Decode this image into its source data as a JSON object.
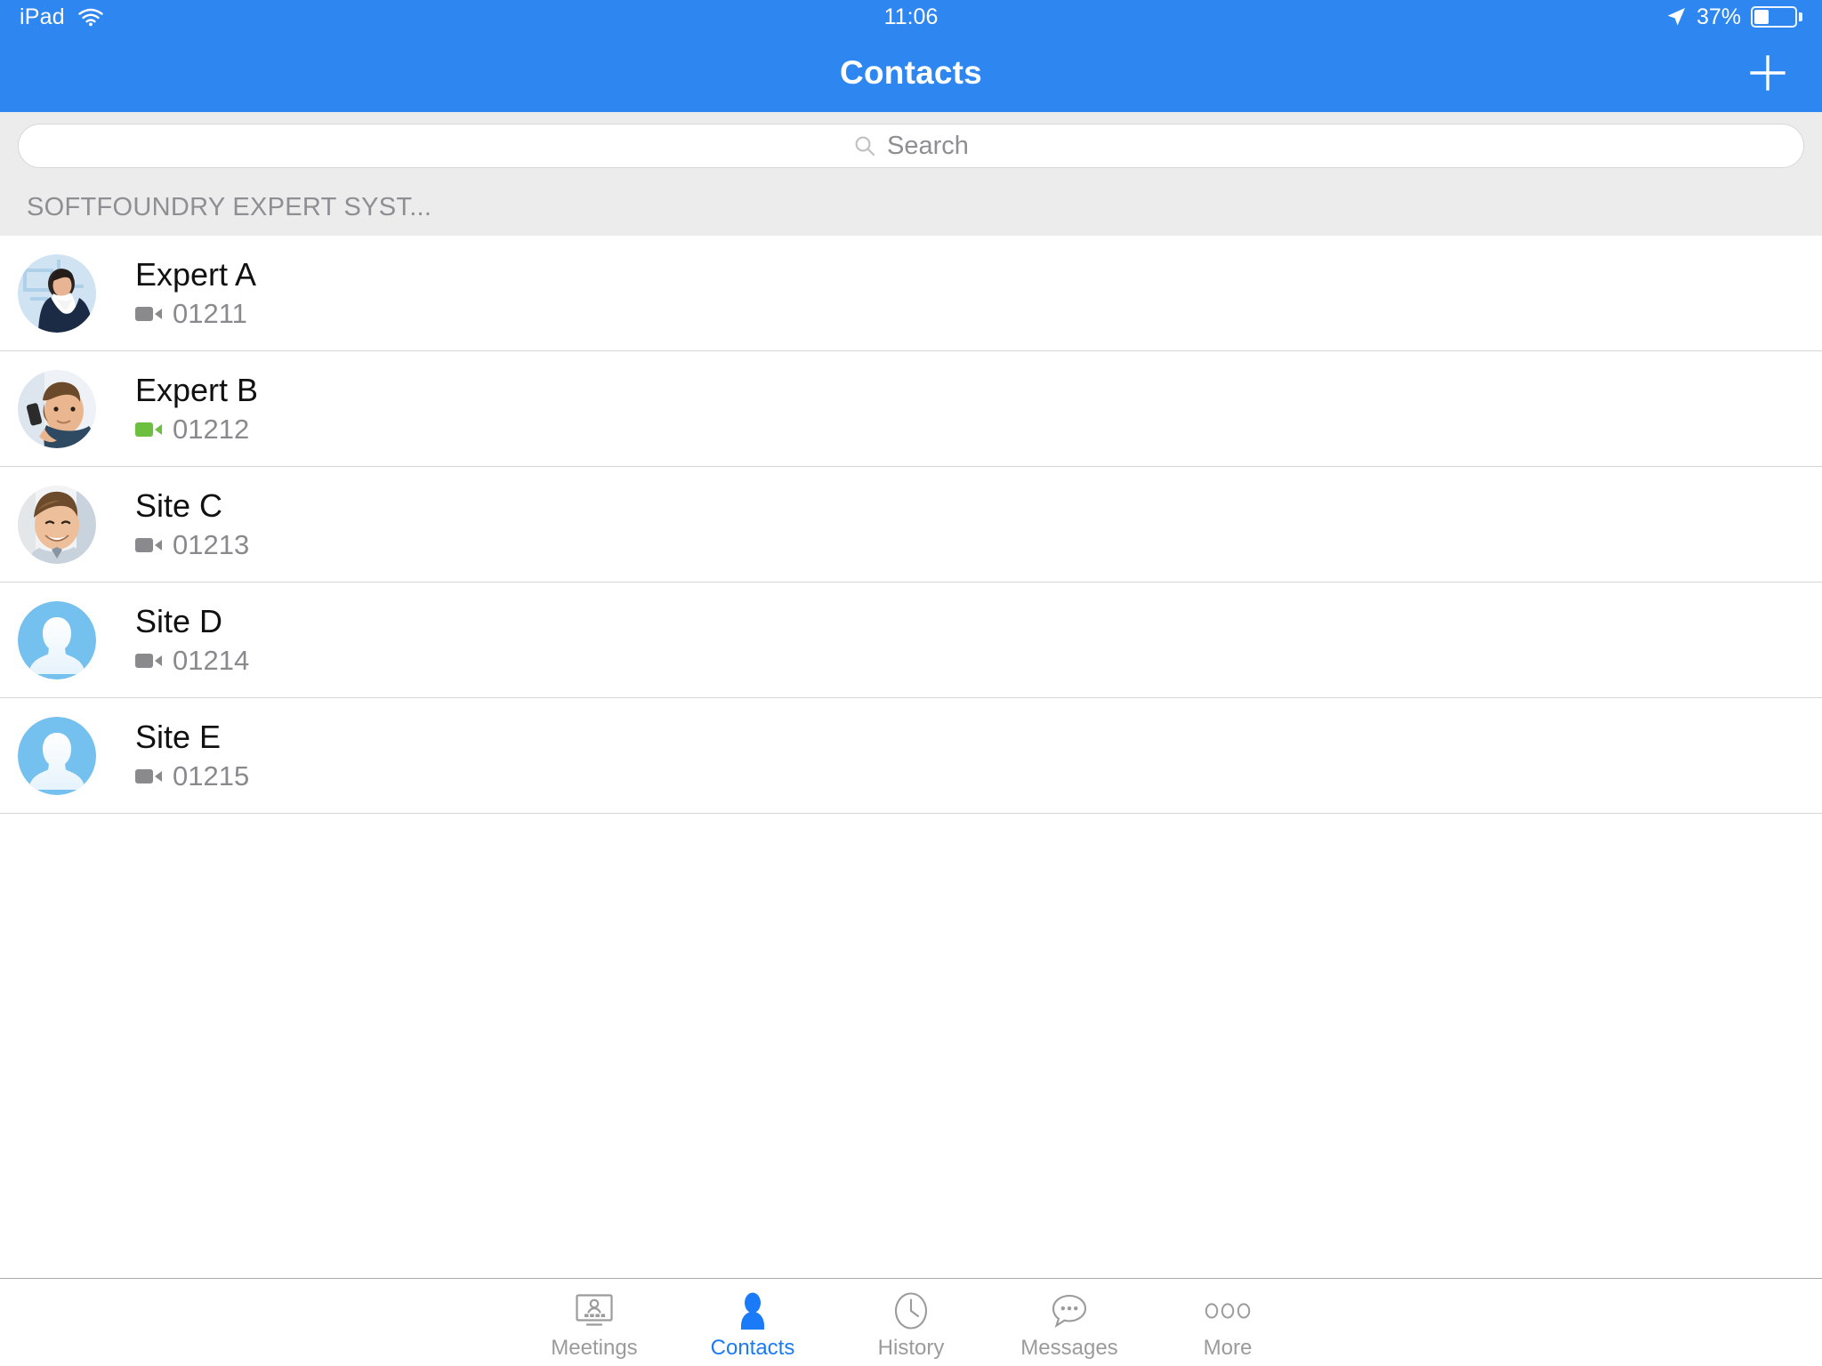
{
  "statusbar": {
    "device": "iPad",
    "wifi_icon": "wifi-icon",
    "time": "11:06",
    "location_icon": "location-arrow-icon",
    "battery_percent": "37%",
    "battery_level": 37
  },
  "navbar": {
    "title": "Contacts",
    "add_icon": "plus-icon",
    "background_color": "#2e86f0"
  },
  "search": {
    "placeholder": "Search",
    "value": "",
    "icon": "search-icon"
  },
  "section": {
    "header": "SOFTFOUNDRY EXPERT SYST..."
  },
  "contacts": [
    {
      "name": "Expert A",
      "extension": "01211",
      "status": "offline",
      "status_color": "#8a8a8e",
      "avatar_type": "photo",
      "avatar_desc": "woman-in-dark-blazer-photo"
    },
    {
      "name": "Expert B",
      "extension": "01212",
      "status": "online",
      "status_color": "#6cbf3f",
      "avatar_type": "photo",
      "avatar_desc": "man-on-phone-photo"
    },
    {
      "name": "Site C",
      "extension": "01213",
      "status": "offline",
      "status_color": "#8a8a8e",
      "avatar_type": "photo",
      "avatar_desc": "smiling-young-man-photo"
    },
    {
      "name": "Site D",
      "extension": "01214",
      "status": "offline",
      "status_color": "#8a8a8e",
      "avatar_type": "placeholder",
      "avatar_desc": "default-person-silhouette"
    },
    {
      "name": "Site E",
      "extension": "01215",
      "status": "offline",
      "status_color": "#8a8a8e",
      "avatar_type": "placeholder",
      "avatar_desc": "default-person-silhouette"
    }
  ],
  "tabbar": {
    "active_color": "#1a7af8",
    "inactive_color": "#9b9b9b",
    "items": [
      {
        "label": "Meetings",
        "icon": "monitor-person-icon",
        "active": false
      },
      {
        "label": "Contacts",
        "icon": "person-icon",
        "active": true
      },
      {
        "label": "History",
        "icon": "clock-icon",
        "active": false
      },
      {
        "label": "Messages",
        "icon": "chat-bubble-icon",
        "active": false
      },
      {
        "label": "More",
        "icon": "three-circles-icon",
        "active": false
      }
    ]
  }
}
